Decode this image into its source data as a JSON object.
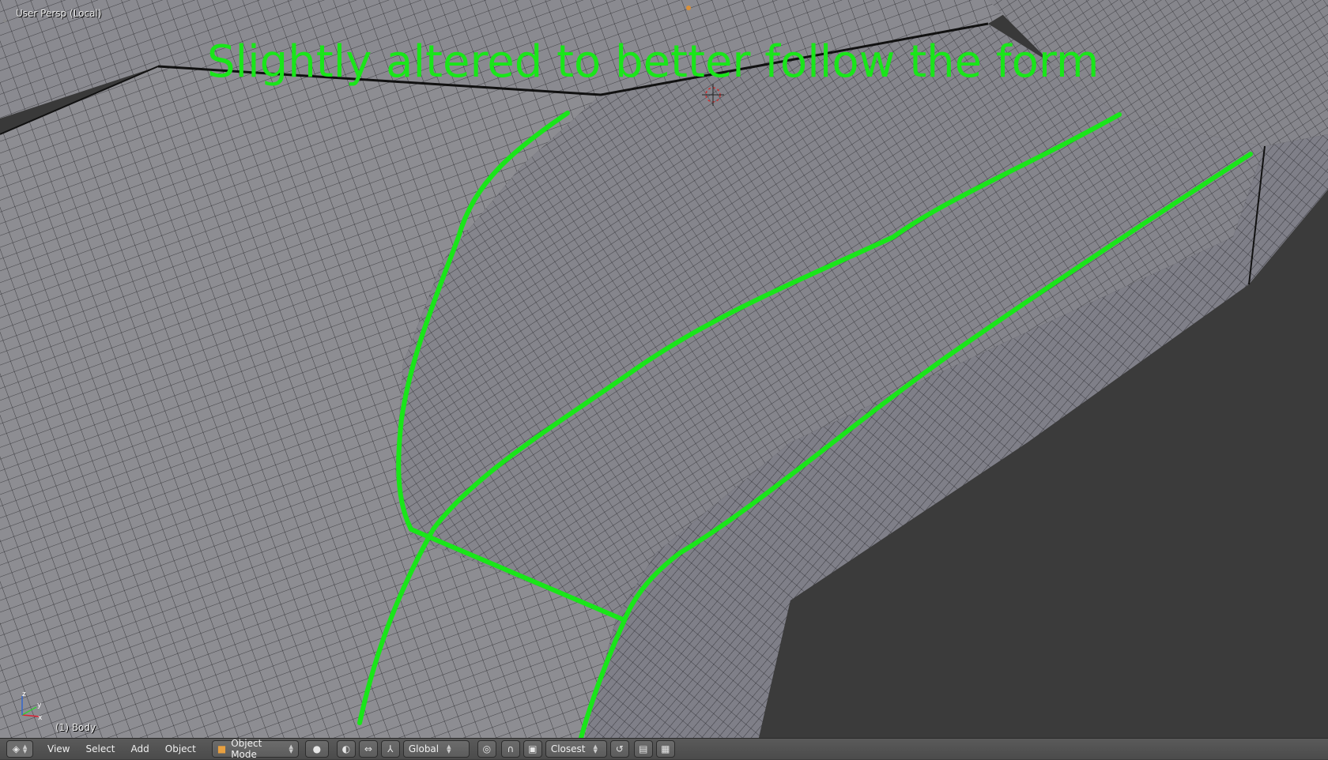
{
  "viewport": {
    "view_label": "User Persp (Local)",
    "object_label": "(1) Body",
    "annotation": "Slightly altered to better follow the form",
    "annotation_color": "#19e619"
  },
  "header": {
    "menus": [
      "View",
      "Select",
      "Add",
      "Object"
    ],
    "mode": "Object Mode",
    "orientation": "Global",
    "snap_target": "Closest"
  },
  "axes": {
    "x": "x",
    "y": "y",
    "z": "z"
  },
  "colors": {
    "mesh": "#8b8b8f",
    "wire": "#1f1f22",
    "background": "#393939"
  }
}
